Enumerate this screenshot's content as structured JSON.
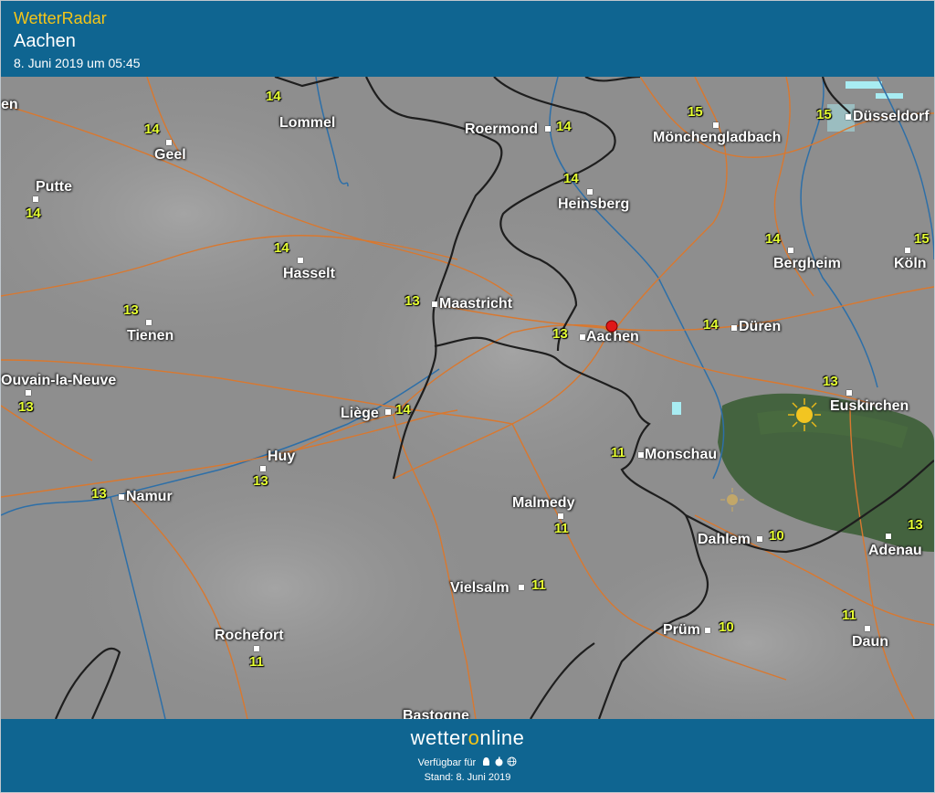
{
  "header": {
    "app_title": "WetterRadar",
    "city": "Aachen",
    "date": "8. Juni 2019 um 05:45"
  },
  "map": {
    "places": [
      {
        "name": "Lommel",
        "temp": "14"
      },
      {
        "name": "Geel",
        "temp": "14"
      },
      {
        "name": "Putte",
        "temp": "14"
      },
      {
        "name": "Roermond",
        "temp": "14"
      },
      {
        "name": "Mönchengladbach",
        "temp": "15"
      },
      {
        "name": "Düsseldorf",
        "temp": "15"
      },
      {
        "name": "Heinsberg",
        "temp": "14"
      },
      {
        "name": "Hasselt",
        "temp": "14"
      },
      {
        "name": "Bergheim",
        "temp": "14"
      },
      {
        "name": "Köln",
        "temp": "15"
      },
      {
        "name": "Maastricht",
        "temp": "13"
      },
      {
        "name": "Tienen",
        "temp": "13"
      },
      {
        "name": "Aachen",
        "temp": "13"
      },
      {
        "name": "Düren",
        "temp": "14"
      },
      {
        "name": "Ouvain-la-Neuve",
        "temp": "13"
      },
      {
        "name": "Liège",
        "temp": "14"
      },
      {
        "name": "Euskirchen",
        "temp": "13"
      },
      {
        "name": "Monschau",
        "temp": "11"
      },
      {
        "name": "Huy",
        "temp": "13"
      },
      {
        "name": "Namur",
        "temp": "13"
      },
      {
        "name": "Malmedy",
        "temp": "11"
      },
      {
        "name": "Dahlem",
        "temp": "10"
      },
      {
        "name": "Adenau",
        "temp": "13"
      },
      {
        "name": "Vielsalm",
        "temp": "11"
      },
      {
        "name": "Rochefort",
        "temp": "11"
      },
      {
        "name": "Prüm",
        "temp": "10"
      },
      {
        "name": "Daun",
        "temp": "11"
      },
      {
        "name": "Bastogne",
        "temp": ""
      },
      {
        "name": "en",
        "temp": ""
      }
    ],
    "marker_icon": "location-pin-icon",
    "sun_icon": "sun-icon"
  },
  "footer": {
    "brand_pre": "wetter",
    "brand_o": "o",
    "brand_post": "nline",
    "available": "Verfügbar für",
    "platform_icons": "android-icon apple-icon web-icon",
    "stand": "Stand: 8. Juni 2019"
  },
  "colors": {
    "header_bg": "#0f6591",
    "accent": "#f5c518",
    "temperature": "#e6ff33",
    "roads": "#d9782f",
    "borders": "#222222",
    "rain_area": "#3c5e36"
  }
}
